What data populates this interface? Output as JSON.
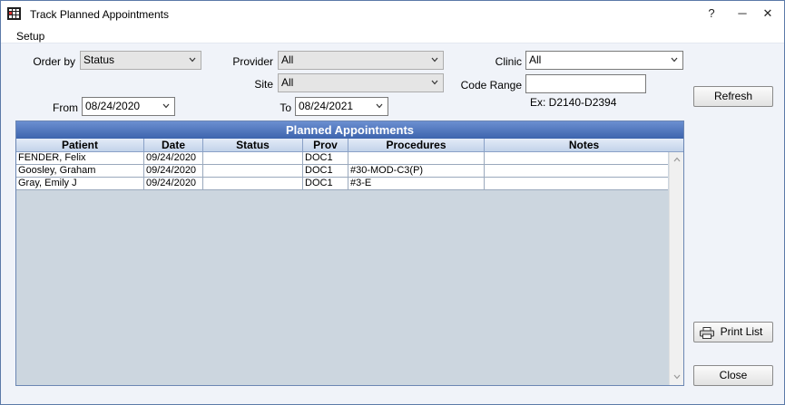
{
  "window": {
    "title": "Track Planned Appointments",
    "help_glyph": "?",
    "minimize_glyph": "─",
    "close_glyph": "✕"
  },
  "menu": {
    "setup": "Setup"
  },
  "filters": {
    "order_by_label": "Order by",
    "order_by_value": "Status",
    "provider_label": "Provider",
    "provider_value": "All",
    "clinic_label": "Clinic",
    "clinic_value": "All",
    "site_label": "Site",
    "site_value": "All",
    "code_range_label": "Code Range",
    "code_range_value": "",
    "code_range_hint": "Ex: D2140-D2394",
    "from_label": "From",
    "from_value": "08/24/2020",
    "to_label": "To",
    "to_value": "08/24/2021"
  },
  "buttons": {
    "refresh": "Refresh",
    "print_list": "Print List",
    "close": "Close"
  },
  "grid": {
    "title": "Planned Appointments",
    "columns": [
      "Patient",
      "Date",
      "Status",
      "Prov",
      "Procedures",
      "Notes"
    ],
    "rows": [
      [
        "FENDER, Felix",
        "09/24/2020",
        "",
        "DOC1",
        "",
        ""
      ],
      [
        "Goosley, Graham",
        "09/24/2020",
        "",
        "DOC1",
        "#30-MOD-C3(P)",
        ""
      ],
      [
        "Gray, Emily J",
        "09/24/2020",
        "",
        "DOC1",
        "#3-E",
        ""
      ]
    ]
  }
}
